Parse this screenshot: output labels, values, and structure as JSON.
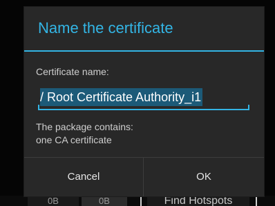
{
  "dialog": {
    "title": "Name the certificate",
    "field_label": "Certificate name:",
    "field_value": "/ Root Certificate Authority_i1",
    "description_lines": [
      "The package contains:",
      "one CA certificate"
    ],
    "cancel_label": "Cancel",
    "ok_label": "OK"
  },
  "background": {
    "cells": [
      "0B",
      "0B",
      "Find Hotspots"
    ]
  },
  "colors": {
    "accent": "#33b5e5",
    "dialog_bg": "#282828",
    "selection": "#1c5a78"
  }
}
